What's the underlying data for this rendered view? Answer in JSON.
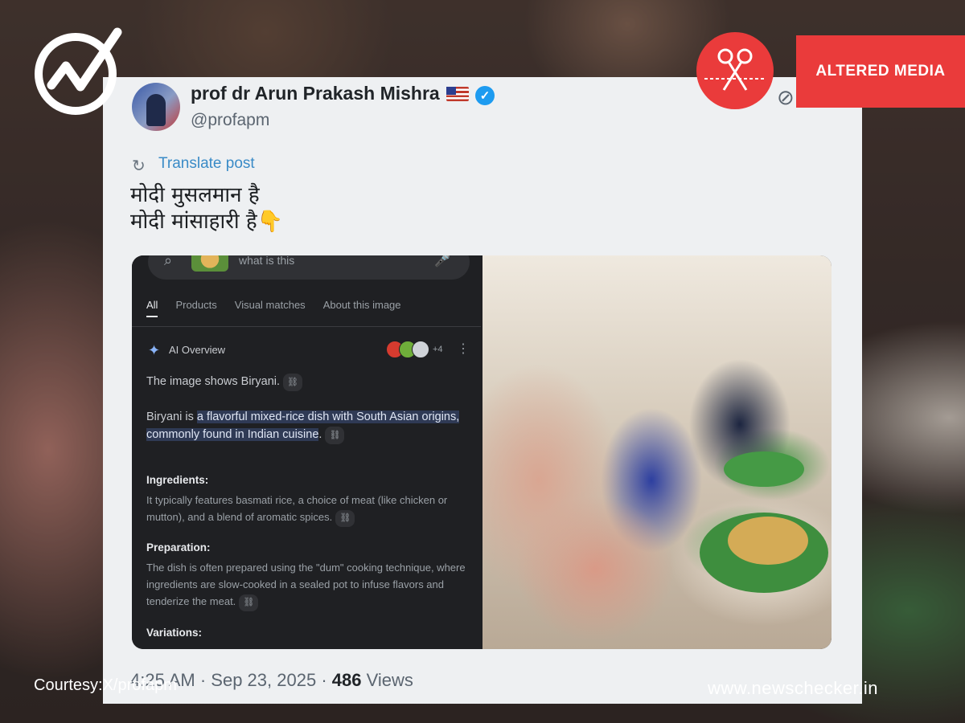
{
  "post": {
    "display_name": "prof dr Arun Prakash Mishra",
    "handle": "@profapm",
    "translate_label": "Translate post",
    "text_line1": "मोदी मुसलमान है",
    "text_line2": "मोदी मांसाहारी है",
    "text_emoji": "👇",
    "time": "4:25 AM",
    "date": "Sep 23, 2025",
    "views_count": "486",
    "views_label": "Views",
    "separator": "·"
  },
  "screenshot_panel": {
    "search_query": "what is this",
    "tabs": [
      "All",
      "Products",
      "Visual matches",
      "About this image"
    ],
    "ai_overview_label": "AI Overview",
    "sources_more": "+4",
    "intro": "The image shows Biryani.",
    "def_prefix": "Biryani is ",
    "def_highlight": "a flavorful mixed-rice dish with South Asian origins, commonly found in Indian cuisine",
    "def_suffix": ".",
    "ingredients_heading": "Ingredients:",
    "ingredients_text": "It typically features basmati rice, a choice of meat (like chicken or mutton), and a blend of aromatic spices.",
    "preparation_heading": "Preparation:",
    "preparation_text": "The dish is often prepared using the \"dum\" cooking technique, where ingredients are slow-cooked in a sealed pot to infuse flavors and tenderize the meat.",
    "variations_heading": "Variations:"
  },
  "overlay": {
    "courtesy": "Courtesy:X/profapm",
    "site": "www.newschecker.in",
    "badge_label": "ALTERED MEDIA"
  },
  "icons": [
    "newschecker-logo-icon",
    "scissors-icon",
    "verified-badge-icon",
    "us-flag-icon",
    "grok-icon",
    "translate-icon",
    "search-icon",
    "mic-icon",
    "sparkle-icon",
    "kebab-menu-icon",
    "link-icon"
  ],
  "colors": {
    "alert_red": "#ea3b3b",
    "verified_blue": "#1d9bf0",
    "link_blue": "#3a8bc7",
    "highlight": "#2f3a55"
  }
}
